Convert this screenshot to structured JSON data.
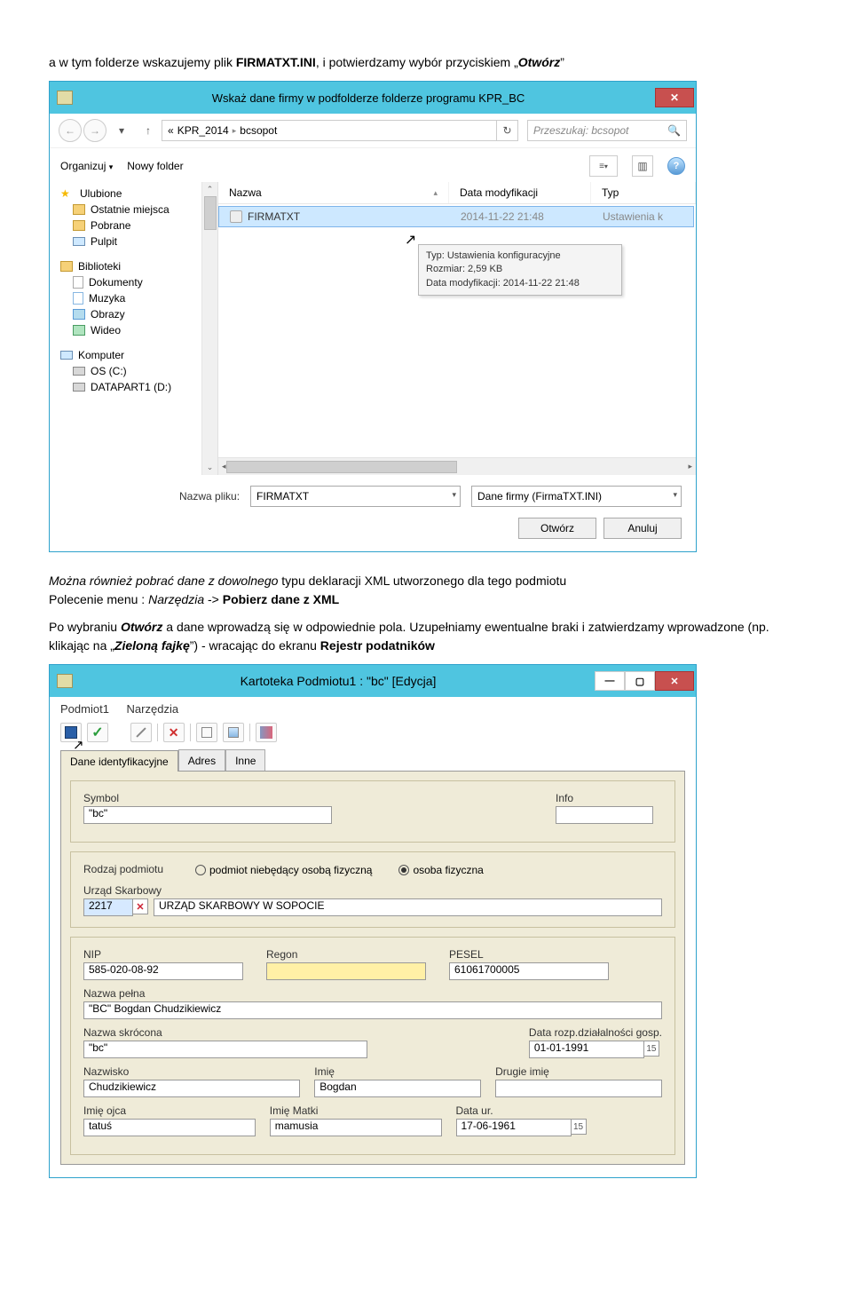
{
  "para1": {
    "a": "a w tym folderze wskazujemy plik ",
    "b": "FIRMATXT.INI",
    "c": ", i potwierdzamy wybór przyciskiem „",
    "d": "Otwórz",
    "e": "”"
  },
  "dialog1": {
    "title": "Wskaż dane firmy w podfolderze folderze programu KPR_BC",
    "close": "✕",
    "back": "←",
    "fwd": "→",
    "up": "↑",
    "down": "▾",
    "crumb_prefix": "«",
    "crumb1": "KPR_2014",
    "crumb2": "bcsopot",
    "chev": "▸",
    "refresh": "↻",
    "search_placeholder": "Przeszukaj: bcsopot",
    "search_icon": "🔍",
    "organize": "Organizuj",
    "orgdd": "▾",
    "newfolder": "Nowy folder",
    "viewicon": "≡",
    "viewdd": "▾",
    "previewicon": "▥",
    "help": "?",
    "tree": {
      "fav": "Ulubione",
      "recent": "Ostatnie miejsca",
      "downloads": "Pobrane",
      "desktop": "Pulpit",
      "libs": "Biblioteki",
      "docs": "Dokumenty",
      "music": "Muzyka",
      "images": "Obrazy",
      "video": "Wideo",
      "computer": "Komputer",
      "osc": "OS (C:)",
      "datapart": "DATAPART1 (D:)"
    },
    "cols": {
      "name": "Nazwa",
      "sort": "▴",
      "date": "Data modyfikacji",
      "type": "Typ"
    },
    "row": {
      "name": "FIRMATXT",
      "date": "2014-11-22 21:48",
      "type": "Ustawienia k"
    },
    "cursor": "↖",
    "tooltip": {
      "l1": "Typ: Ustawienia konfiguracyjne",
      "l2": "Rozmiar: 2,59 KB",
      "l3": "Data modyfikacji: 2014-11-22 21:48"
    },
    "scroll_up": "⌃",
    "scroll_dn": "⌄",
    "scroll_l": "◂",
    "scroll_r": "▸",
    "footer": {
      "label": "Nazwa pliku:",
      "value": "FIRMATXT",
      "typefilter": "Dane firmy (FirmaTXT.INI)",
      "dd": "▾",
      "open": "Otwórz",
      "cancel": "Anuluj"
    }
  },
  "para2": {
    "a": "Można również pobrać dane z dowolnego",
    "b": " typu deklaracji XML utworzonego dla tego podmiotu",
    "line2a": "Polecenie menu : ",
    "line2b": "Narzędzia",
    "line2c": " -> ",
    "line2d": "Pobierz dane z XML"
  },
  "para3": {
    "a": "Po wybraniu ",
    "b": "Otwórz",
    "c": " a dane wprowadzą się w odpowiednie pola. Uzupełniamy ewentualne braki i zatwierdzamy wprowadzone (np. klikając na „",
    "d": "Zieloną fajkę",
    "e": "”)  - wracając do ekranu ",
    "f": "Rejestr podatników"
  },
  "dialog2": {
    "title": "Kartoteka Podmiotu1 : \"bc\" [Edycja]",
    "min": "—",
    "max": "▢",
    "close": "✕",
    "menu": {
      "podmiot": "Podmiot1",
      "narz": "Narzędzia"
    },
    "tabs": {
      "t1": "Dane identyfikacyjne",
      "t2": "Adres",
      "t3": "Inne"
    },
    "cursor": "↖",
    "labels": {
      "symbol": "Symbol",
      "info": "Info",
      "rodzaj": "Rodzaj podmiotu",
      "opt1": "podmiot niebędący osobą fizyczną",
      "opt2": "osoba fizyczna",
      "urzad": "Urząd Skarbowy",
      "nip": "NIP",
      "regon": "Regon",
      "pesel": "PESEL",
      "nazwapel": "Nazwa pełna",
      "nazwaskr": "Nazwa skrócona",
      "datarozp": "Data rozp.działalności gosp.",
      "nazwisko": "Nazwisko",
      "imie": "Imię",
      "drugieimie": "Drugie imię",
      "imieojca": "Imię ojca",
      "imiematki": "Imię Matki",
      "dataur": "Data ur."
    },
    "values": {
      "symbol": "\"bc\"",
      "info": "",
      "urzadcode": "2217",
      "urzadclear": "✕",
      "urzadname": "URZĄD SKARBOWY W SOPOCIE",
      "nip": "585-020-08-92",
      "regon": "",
      "pesel": "61061700005",
      "nazwapel": "\"BC\" Bogdan Chudzikiewicz",
      "nazwaskr": "\"bc\"",
      "datarozp": "01-01-1991",
      "nazwisko": "Chudzikiewicz",
      "imie": "Bogdan",
      "drugieimie": "",
      "imieojca": "tatuś",
      "imiematki": "mamusia",
      "dataur": "17-06-1961",
      "cal": "15"
    }
  }
}
